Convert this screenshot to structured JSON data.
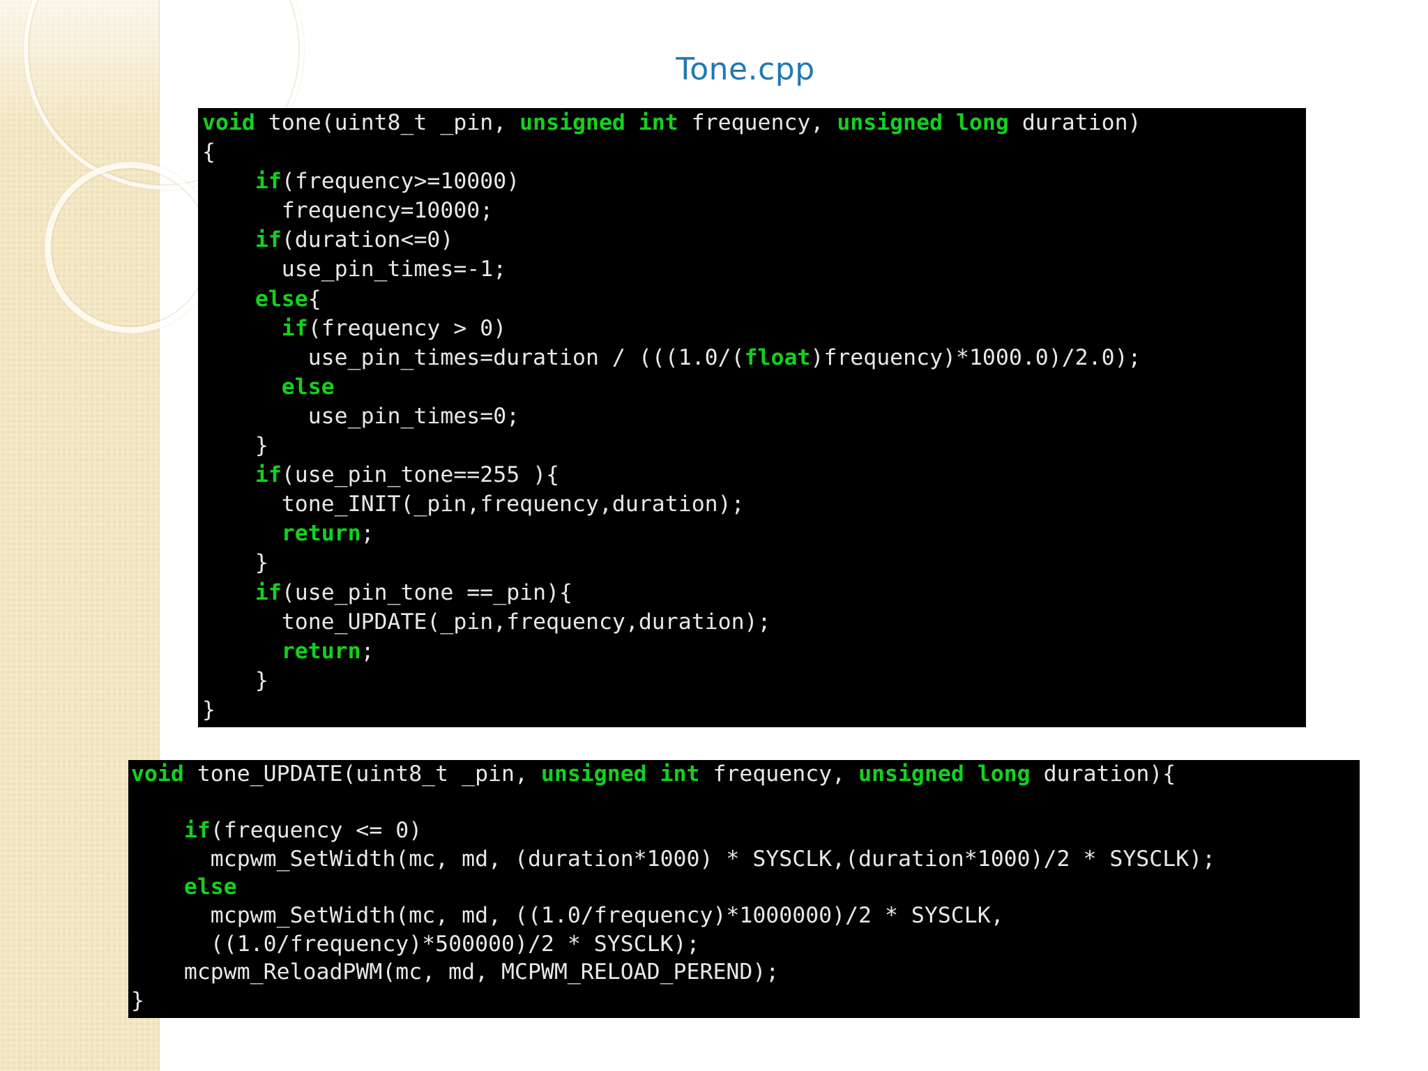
{
  "slide": {
    "title": "Tone.cpp"
  },
  "colors": {
    "title": "#1f78b4",
    "code_background": "#000000",
    "code_text": "#e8e8e8",
    "keyword": "#11d21e"
  },
  "code_blocks": [
    {
      "name": "tone-function",
      "lines": [
        [
          {
            "t": "void",
            "k": true
          },
          {
            "t": " tone(uint8_t _pin, "
          },
          {
            "t": "unsigned int",
            "k": true
          },
          {
            "t": " frequency, "
          },
          {
            "t": "unsigned long",
            "k": true
          },
          {
            "t": " duration)"
          }
        ],
        [
          {
            "t": "{"
          }
        ],
        [
          {
            "t": "    "
          },
          {
            "t": "if",
            "k": true
          },
          {
            "t": "(frequency>=10000)"
          }
        ],
        [
          {
            "t": "      frequency=10000;"
          }
        ],
        [
          {
            "t": "    "
          },
          {
            "t": "if",
            "k": true
          },
          {
            "t": "(duration<=0)"
          }
        ],
        [
          {
            "t": "      use_pin_times=-1;"
          }
        ],
        [
          {
            "t": "    "
          },
          {
            "t": "else",
            "k": true
          },
          {
            "t": "{"
          }
        ],
        [
          {
            "t": "      "
          },
          {
            "t": "if",
            "k": true
          },
          {
            "t": "(frequency > 0)"
          }
        ],
        [
          {
            "t": "        use_pin_times=duration / (((1.0/("
          },
          {
            "t": "float",
            "k": true
          },
          {
            "t": ")frequency)*1000.0)/2.0);"
          }
        ],
        [
          {
            "t": "      "
          },
          {
            "t": "else",
            "k": true
          }
        ],
        [
          {
            "t": "        use_pin_times=0;"
          }
        ],
        [
          {
            "t": "    }"
          }
        ],
        [
          {
            "t": "    "
          },
          {
            "t": "if",
            "k": true
          },
          {
            "t": "(use_pin_tone==255 ){"
          }
        ],
        [
          {
            "t": "      tone_INIT(_pin,frequency,duration);"
          }
        ],
        [
          {
            "t": "      "
          },
          {
            "t": "return",
            "k": true
          },
          {
            "t": ";"
          }
        ],
        [
          {
            "t": "    }"
          }
        ],
        [
          {
            "t": "    "
          },
          {
            "t": "if",
            "k": true
          },
          {
            "t": "(use_pin_tone ==_pin){"
          }
        ],
        [
          {
            "t": "      tone_UPDATE(_pin,frequency,duration);"
          }
        ],
        [
          {
            "t": "      "
          },
          {
            "t": "return",
            "k": true
          },
          {
            "t": ";"
          }
        ],
        [
          {
            "t": "    }"
          }
        ],
        [
          {
            "t": "}"
          }
        ]
      ]
    },
    {
      "name": "tone-update-function",
      "lines": [
        [
          {
            "t": "void",
            "k": true
          },
          {
            "t": " tone_UPDATE(uint8_t _pin, "
          },
          {
            "t": "unsigned int",
            "k": true
          },
          {
            "t": " frequency, "
          },
          {
            "t": "unsigned long",
            "k": true
          },
          {
            "t": " duration){"
          }
        ],
        [
          {
            "t": ""
          }
        ],
        [
          {
            "t": "    "
          },
          {
            "t": "if",
            "k": true
          },
          {
            "t": "(frequency <= 0)"
          }
        ],
        [
          {
            "t": "      mcpwm_SetWidth(mc, md, (duration*1000) * SYSCLK,(duration*1000)/2 * SYSCLK);"
          }
        ],
        [
          {
            "t": "    "
          },
          {
            "t": "else",
            "k": true
          }
        ],
        [
          {
            "t": "      mcpwm_SetWidth(mc, md, ((1.0/frequency)*1000000)/2 * SYSCLK,"
          }
        ],
        [
          {
            "t": "      ((1.0/frequency)*500000)/2 * SYSCLK);"
          }
        ],
        [
          {
            "t": "    mcpwm_ReloadPWM(mc, md, MCPWM_RELOAD_PEREND);"
          }
        ],
        [
          {
            "t": "}"
          }
        ]
      ]
    }
  ]
}
